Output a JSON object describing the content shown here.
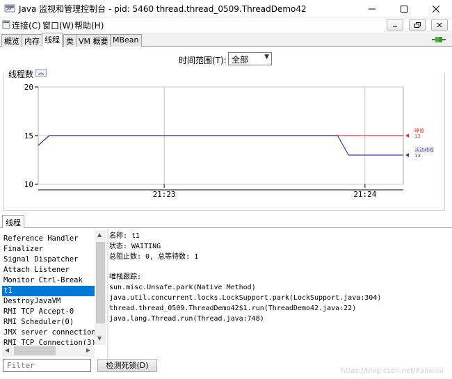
{
  "window": {
    "title": "Java 监视和管理控制台 - pid: 5460 thread.thread_0509.ThreadDemo42"
  },
  "menu": {
    "items": [
      "连接(C)",
      "窗口(W)",
      "帮助(H)"
    ]
  },
  "tabs": [
    {
      "label": "概览",
      "active": false
    },
    {
      "label": "内存",
      "active": false
    },
    {
      "label": "线程",
      "active": true
    },
    {
      "label": "类",
      "active": false
    },
    {
      "label": "VM 概要",
      "active": false
    },
    {
      "label": "MBean",
      "active": false
    }
  ],
  "range": {
    "label": "时间范围(T):",
    "value": "全部"
  },
  "chart_title": "线程数",
  "chart_data": {
    "type": "line",
    "title": "线程数",
    "x_ticks": [
      "21:23",
      "21:24"
    ],
    "ylim": [
      10,
      20
    ],
    "y_ticks": [
      10,
      15,
      20
    ],
    "grid": true,
    "series": [
      {
        "name": "峰值",
        "color": "#e03c3c",
        "current": 13,
        "points": [
          [
            0,
            14
          ],
          [
            0.03,
            15
          ],
          [
            0.82,
            15
          ],
          [
            1.0,
            15
          ]
        ]
      },
      {
        "name": "活动线程",
        "color": "#3c3ca8",
        "current": 13,
        "points": [
          [
            0,
            14
          ],
          [
            0.03,
            15
          ],
          [
            0.82,
            15
          ],
          [
            0.85,
            13
          ],
          [
            1.0,
            13
          ]
        ]
      }
    ]
  },
  "threads_tab": "线程",
  "thread_list": [
    "Reference Handler",
    "Finalizer",
    "Signal Dispatcher",
    "Attach Listener",
    "Monitor Ctrl-Break",
    "t1",
    "DestroyJavaVM",
    "RMI TCP Accept-0",
    "RMI Scheduler(0)",
    "JMX server connection",
    "RMI TCP Connection(3)-"
  ],
  "selected_thread": "t1",
  "detail": {
    "name": "名称: t1",
    "state": "状态: WAITING",
    "counts": "总阻止数: 0, 总等待数: 1",
    "stack_title": "堆栈跟踪:",
    "stack": [
      "sun.misc.Unsafe.park(Native Method)",
      "java.util.concurrent.locks.LockSupport.park(LockSupport.java:304)",
      "thread.thread_0509.ThreadDemo42$1.run(ThreadDemo42.java:22)",
      "java.lang.Thread.run(Thread.java:748)"
    ]
  },
  "filter": {
    "placeholder": "Filter"
  },
  "deadlock_button": "检测死锁(D)",
  "watermark": "https://blog.csdn.net/Xaliiiiiiiii"
}
